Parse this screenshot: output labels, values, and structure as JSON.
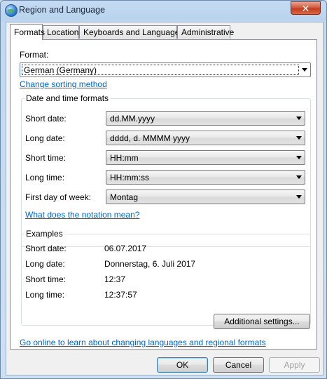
{
  "window": {
    "title": "Region and Language",
    "close_glyph": "✕"
  },
  "tabs": [
    {
      "label": "Formats"
    },
    {
      "label": "Location"
    },
    {
      "label": "Keyboards and Languages"
    },
    {
      "label": "Administrative"
    }
  ],
  "format": {
    "label": "Format:",
    "value": "German (Germany)",
    "change_sorting_link": "Change sorting method"
  },
  "date_time": {
    "group_title": "Date and time formats",
    "short_date": {
      "label": "Short date:",
      "value": "dd.MM.yyyy"
    },
    "long_date": {
      "label": "Long date:",
      "value": "dddd, d. MMMM yyyy"
    },
    "short_time": {
      "label": "Short time:",
      "value": "HH:mm"
    },
    "long_time": {
      "label": "Long time:",
      "value": "HH:mm:ss"
    },
    "first_day": {
      "label": "First day of week:",
      "value": "Montag"
    },
    "notation_link": "What does the notation mean?"
  },
  "examples": {
    "group_title": "Examples",
    "rows": [
      {
        "label": "Short date:",
        "value": "06.07.2017"
      },
      {
        "label": "Long date:",
        "value": "Donnerstag, 6. Juli 2017"
      },
      {
        "label": "Short time:",
        "value": "12:37"
      },
      {
        "label": "Long time:",
        "value": "12:37:57"
      }
    ]
  },
  "additional_settings_label": "Additional settings...",
  "online_link": "Go online to learn about changing languages and regional formats",
  "buttons": {
    "ok": "OK",
    "cancel": "Cancel",
    "apply": "Apply"
  }
}
